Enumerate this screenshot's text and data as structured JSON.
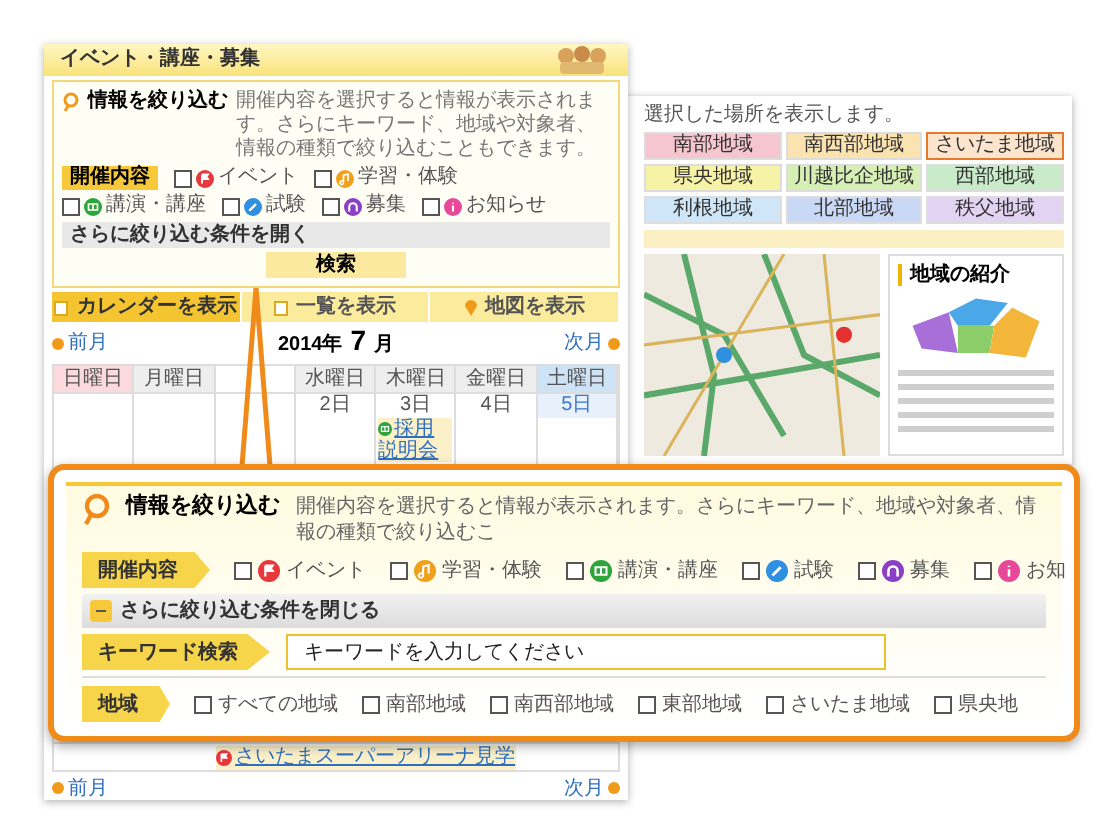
{
  "page": {
    "title": "イベント・講座・募集",
    "filter": {
      "title": "情報を絞り込む",
      "description": "開催内容を選択すると情報が表示されます。さらにキーワード、地域や対象者、情報の種類で絞り込むこともできます。",
      "category_label": "開催内容",
      "categories": [
        {
          "kind": "event",
          "label": "イベント",
          "checked": false
        },
        {
          "kind": "learning",
          "label": "学習・体験",
          "checked": false
        },
        {
          "kind": "lecture",
          "label": "講演・講座",
          "checked": false
        },
        {
          "kind": "exam",
          "label": "試験",
          "checked": false
        },
        {
          "kind": "recruit",
          "label": "募集",
          "checked": false
        },
        {
          "kind": "notice",
          "label": "お知らせ",
          "checked": false
        }
      ],
      "more_toggle": "さらに絞り込む条件を開く",
      "search_button": "検索"
    },
    "view_tabs": [
      {
        "label": "カレンダーを表示",
        "kind": "calendar",
        "selected": true
      },
      {
        "label": "一覧を表示",
        "kind": "list",
        "selected": false
      },
      {
        "label": "地図を表示",
        "kind": "map",
        "selected": false
      }
    ],
    "calendar": {
      "prev": "前月",
      "year": "2014年",
      "month": "7",
      "month_unit": "月",
      "next": "次月",
      "weekdays": [
        {
          "label": "日曜日"
        },
        {
          "label": "月曜日",
          "covered": false
        },
        {
          "covered": true
        },
        {
          "label": "水曜日"
        },
        {
          "label": "木曜日"
        },
        {
          "label": "金曜日"
        },
        {
          "label": "土曜日"
        }
      ],
      "weeks": [
        {
          "cells": [
            {},
            {},
            {},
            {
              "day": "2日"
            },
            {
              "day": "3日",
              "event": {
                "kind": "lecture",
                "text": "採用説明会"
              }
            },
            {
              "day": "4日"
            },
            {
              "day": "5日"
            }
          ]
        }
      ],
      "bottom_event": {
        "kind": "event",
        "text": "さいたまスーパーアリーナ見学"
      },
      "bottom_prev": "前月",
      "bottom_next": "次月"
    }
  },
  "map_panel": {
    "hint": "選択した場所を表示します。",
    "regions": [
      {
        "label": "南部地域",
        "color": "#f6c6d0",
        "selected": false
      },
      {
        "label": "南西部地域",
        "color": "#fbe3b0",
        "selected": false
      },
      {
        "label": "さいたま地域",
        "color": "#fde4cc",
        "selected": true
      },
      {
        "label": "県央地域",
        "color": "#f7f3a6",
        "selected": false
      },
      {
        "label": "川越比企地域",
        "color": "#d6efb5",
        "selected": false
      },
      {
        "label": "西部地域",
        "color": "#c9ebc9",
        "selected": false
      },
      {
        "label": "利根地域",
        "color": "#cfe6f8",
        "selected": false
      },
      {
        "label": "北部地域",
        "color": "#c9d9f5",
        "selected": false
      },
      {
        "label": "秩父地域",
        "color": "#e3d3f2",
        "selected": false
      }
    ],
    "legend_title": "地域の紹介"
  },
  "zoom": {
    "title": "情報を絞り込む",
    "description": "開催内容を選択すると情報が表示されます。さらにキーワード、地域や対象者、情報の種類で絞り込むこ",
    "category_label": "開催内容",
    "categories": [
      {
        "kind": "event",
        "label": "イベント",
        "checked": false
      },
      {
        "kind": "learning",
        "label": "学習・体験",
        "checked": false
      },
      {
        "kind": "lecture",
        "label": "講演・講座",
        "checked": false
      },
      {
        "kind": "exam",
        "label": "試験",
        "checked": false
      },
      {
        "kind": "recruit",
        "label": "募集",
        "checked": false
      },
      {
        "kind": "notice",
        "label": "お知",
        "checked": false
      }
    ],
    "less_toggle": "さらに絞り込む条件を閉じる",
    "keyword_label": "キーワード検索",
    "keyword": {
      "placeholder": "キーワードを入力してください"
    },
    "region_label": "地域",
    "regions": [
      {
        "label": "すべての地域",
        "checked": false
      },
      {
        "label": "南部地域",
        "checked": false
      },
      {
        "label": "南西部地域",
        "checked": false
      },
      {
        "label": "東部地域",
        "checked": false
      },
      {
        "label": "さいたま地域",
        "checked": false
      },
      {
        "label": "県央地",
        "checked": false
      }
    ]
  }
}
